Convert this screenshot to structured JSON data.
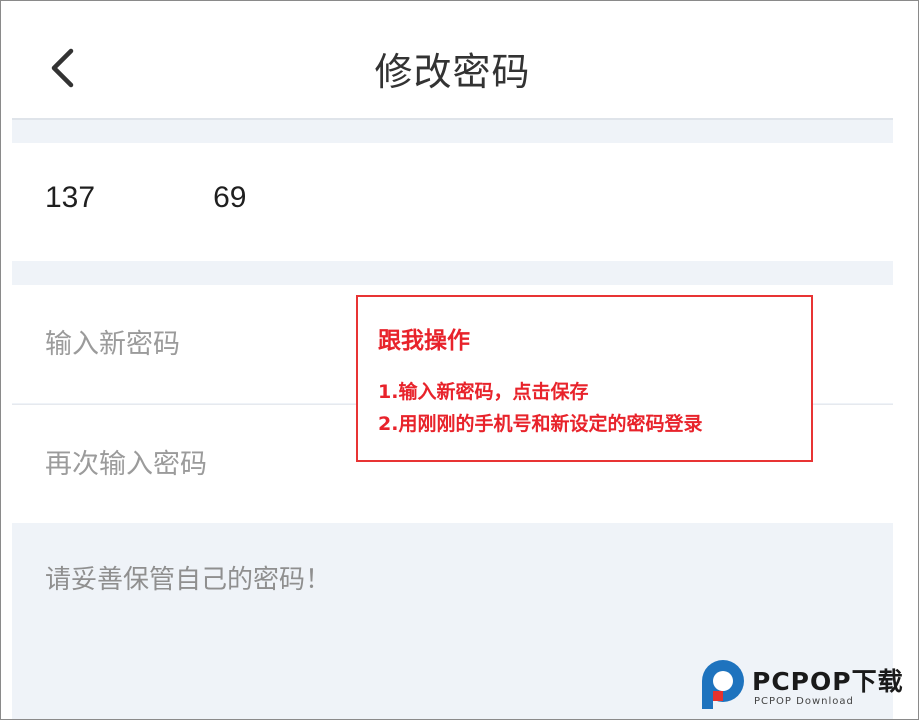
{
  "header": {
    "title": "修改密码",
    "back_icon": "chevron-left-icon"
  },
  "account": {
    "phone_visible_start": "137",
    "phone_visible_end": "69"
  },
  "form": {
    "new_password_placeholder": "输入新密码",
    "confirm_password_placeholder": "再次输入密码"
  },
  "tip": "请妥善保管自己的密码！",
  "callout": {
    "title": "跟我操作",
    "steps": [
      "1.输入新密码，点击保存",
      "2.用刚刚的手机号和新设定的密码登录"
    ],
    "color": "#e8232b"
  },
  "watermark": {
    "brand": "PCPOP下载",
    "sub": "PCPOP Download",
    "colors": [
      "#1e73be",
      "#e5322d"
    ]
  }
}
